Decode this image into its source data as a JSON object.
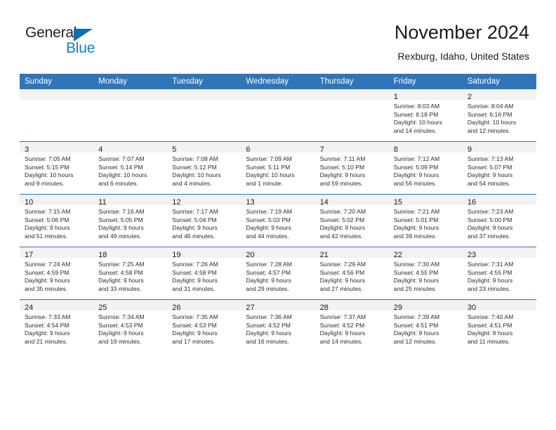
{
  "brand": {
    "name_part1": "General",
    "name_part2": "Blue",
    "triangle_color": "#0f6cb6",
    "blue_text_color": "#1b79c6"
  },
  "header": {
    "title": "November 2024",
    "subtitle": "Rexburg, Idaho, United States",
    "accent_color": "#3075b8",
    "daynum_strip_color": "#f2f2f2"
  },
  "weekday_headers": [
    "Sunday",
    "Monday",
    "Tuesday",
    "Wednesday",
    "Thursday",
    "Friday",
    "Saturday"
  ],
  "weeks": [
    [
      {
        "day": "",
        "sunrise": "",
        "sunset": "",
        "daylight1": "",
        "daylight2": ""
      },
      {
        "day": "",
        "sunrise": "",
        "sunset": "",
        "daylight1": "",
        "daylight2": ""
      },
      {
        "day": "",
        "sunrise": "",
        "sunset": "",
        "daylight1": "",
        "daylight2": ""
      },
      {
        "day": "",
        "sunrise": "",
        "sunset": "",
        "daylight1": "",
        "daylight2": ""
      },
      {
        "day": "",
        "sunrise": "",
        "sunset": "",
        "daylight1": "",
        "daylight2": ""
      },
      {
        "day": "1",
        "sunrise": "Sunrise: 8:03 AM",
        "sunset": "Sunset: 6:18 PM",
        "daylight1": "Daylight: 10 hours",
        "daylight2": "and 14 minutes."
      },
      {
        "day": "2",
        "sunrise": "Sunrise: 8:04 AM",
        "sunset": "Sunset: 6:16 PM",
        "daylight1": "Daylight: 10 hours",
        "daylight2": "and 12 minutes."
      }
    ],
    [
      {
        "day": "3",
        "sunrise": "Sunrise: 7:05 AM",
        "sunset": "Sunset: 5:15 PM",
        "daylight1": "Daylight: 10 hours",
        "daylight2": "and 9 minutes."
      },
      {
        "day": "4",
        "sunrise": "Sunrise: 7:07 AM",
        "sunset": "Sunset: 5:14 PM",
        "daylight1": "Daylight: 10 hours",
        "daylight2": "and 6 minutes."
      },
      {
        "day": "5",
        "sunrise": "Sunrise: 7:08 AM",
        "sunset": "Sunset: 5:12 PM",
        "daylight1": "Daylight: 10 hours",
        "daylight2": "and 4 minutes."
      },
      {
        "day": "6",
        "sunrise": "Sunrise: 7:09 AM",
        "sunset": "Sunset: 5:11 PM",
        "daylight1": "Daylight: 10 hours",
        "daylight2": "and 1 minute."
      },
      {
        "day": "7",
        "sunrise": "Sunrise: 7:11 AM",
        "sunset": "Sunset: 5:10 PM",
        "daylight1": "Daylight: 9 hours",
        "daylight2": "and 59 minutes."
      },
      {
        "day": "8",
        "sunrise": "Sunrise: 7:12 AM",
        "sunset": "Sunset: 5:09 PM",
        "daylight1": "Daylight: 9 hours",
        "daylight2": "and 56 minutes."
      },
      {
        "day": "9",
        "sunrise": "Sunrise: 7:13 AM",
        "sunset": "Sunset: 5:07 PM",
        "daylight1": "Daylight: 9 hours",
        "daylight2": "and 54 minutes."
      }
    ],
    [
      {
        "day": "10",
        "sunrise": "Sunrise: 7:15 AM",
        "sunset": "Sunset: 5:06 PM",
        "daylight1": "Daylight: 9 hours",
        "daylight2": "and 51 minutes."
      },
      {
        "day": "11",
        "sunrise": "Sunrise: 7:16 AM",
        "sunset": "Sunset: 5:05 PM",
        "daylight1": "Daylight: 9 hours",
        "daylight2": "and 49 minutes."
      },
      {
        "day": "12",
        "sunrise": "Sunrise: 7:17 AM",
        "sunset": "Sunset: 5:04 PM",
        "daylight1": "Daylight: 9 hours",
        "daylight2": "and 46 minutes."
      },
      {
        "day": "13",
        "sunrise": "Sunrise: 7:19 AM",
        "sunset": "Sunset: 5:03 PM",
        "daylight1": "Daylight: 9 hours",
        "daylight2": "and 44 minutes."
      },
      {
        "day": "14",
        "sunrise": "Sunrise: 7:20 AM",
        "sunset": "Sunset: 5:02 PM",
        "daylight1": "Daylight: 9 hours",
        "daylight2": "and 42 minutes."
      },
      {
        "day": "15",
        "sunrise": "Sunrise: 7:21 AM",
        "sunset": "Sunset: 5:01 PM",
        "daylight1": "Daylight: 9 hours",
        "daylight2": "and 39 minutes."
      },
      {
        "day": "16",
        "sunrise": "Sunrise: 7:23 AM",
        "sunset": "Sunset: 5:00 PM",
        "daylight1": "Daylight: 9 hours",
        "daylight2": "and 37 minutes."
      }
    ],
    [
      {
        "day": "17",
        "sunrise": "Sunrise: 7:24 AM",
        "sunset": "Sunset: 4:59 PM",
        "daylight1": "Daylight: 9 hours",
        "daylight2": "and 35 minutes."
      },
      {
        "day": "18",
        "sunrise": "Sunrise: 7:25 AM",
        "sunset": "Sunset: 4:58 PM",
        "daylight1": "Daylight: 9 hours",
        "daylight2": "and 33 minutes."
      },
      {
        "day": "19",
        "sunrise": "Sunrise: 7:26 AM",
        "sunset": "Sunset: 4:58 PM",
        "daylight1": "Daylight: 9 hours",
        "daylight2": "and 31 minutes."
      },
      {
        "day": "20",
        "sunrise": "Sunrise: 7:28 AM",
        "sunset": "Sunset: 4:57 PM",
        "daylight1": "Daylight: 9 hours",
        "daylight2": "and 29 minutes."
      },
      {
        "day": "21",
        "sunrise": "Sunrise: 7:29 AM",
        "sunset": "Sunset: 4:56 PM",
        "daylight1": "Daylight: 9 hours",
        "daylight2": "and 27 minutes."
      },
      {
        "day": "22",
        "sunrise": "Sunrise: 7:30 AM",
        "sunset": "Sunset: 4:55 PM",
        "daylight1": "Daylight: 9 hours",
        "daylight2": "and 25 minutes."
      },
      {
        "day": "23",
        "sunrise": "Sunrise: 7:31 AM",
        "sunset": "Sunset: 4:55 PM",
        "daylight1": "Daylight: 9 hours",
        "daylight2": "and 23 minutes."
      }
    ],
    [
      {
        "day": "24",
        "sunrise": "Sunrise: 7:33 AM",
        "sunset": "Sunset: 4:54 PM",
        "daylight1": "Daylight: 9 hours",
        "daylight2": "and 21 minutes."
      },
      {
        "day": "25",
        "sunrise": "Sunrise: 7:34 AM",
        "sunset": "Sunset: 4:53 PM",
        "daylight1": "Daylight: 9 hours",
        "daylight2": "and 19 minutes."
      },
      {
        "day": "26",
        "sunrise": "Sunrise: 7:35 AM",
        "sunset": "Sunset: 4:53 PM",
        "daylight1": "Daylight: 9 hours",
        "daylight2": "and 17 minutes."
      },
      {
        "day": "27",
        "sunrise": "Sunrise: 7:36 AM",
        "sunset": "Sunset: 4:52 PM",
        "daylight1": "Daylight: 9 hours",
        "daylight2": "and 16 minutes."
      },
      {
        "day": "28",
        "sunrise": "Sunrise: 7:37 AM",
        "sunset": "Sunset: 4:52 PM",
        "daylight1": "Daylight: 9 hours",
        "daylight2": "and 14 minutes."
      },
      {
        "day": "29",
        "sunrise": "Sunrise: 7:39 AM",
        "sunset": "Sunset: 4:51 PM",
        "daylight1": "Daylight: 9 hours",
        "daylight2": "and 12 minutes."
      },
      {
        "day": "30",
        "sunrise": "Sunrise: 7:40 AM",
        "sunset": "Sunset: 4:51 PM",
        "daylight1": "Daylight: 9 hours",
        "daylight2": "and 11 minutes."
      }
    ]
  ]
}
